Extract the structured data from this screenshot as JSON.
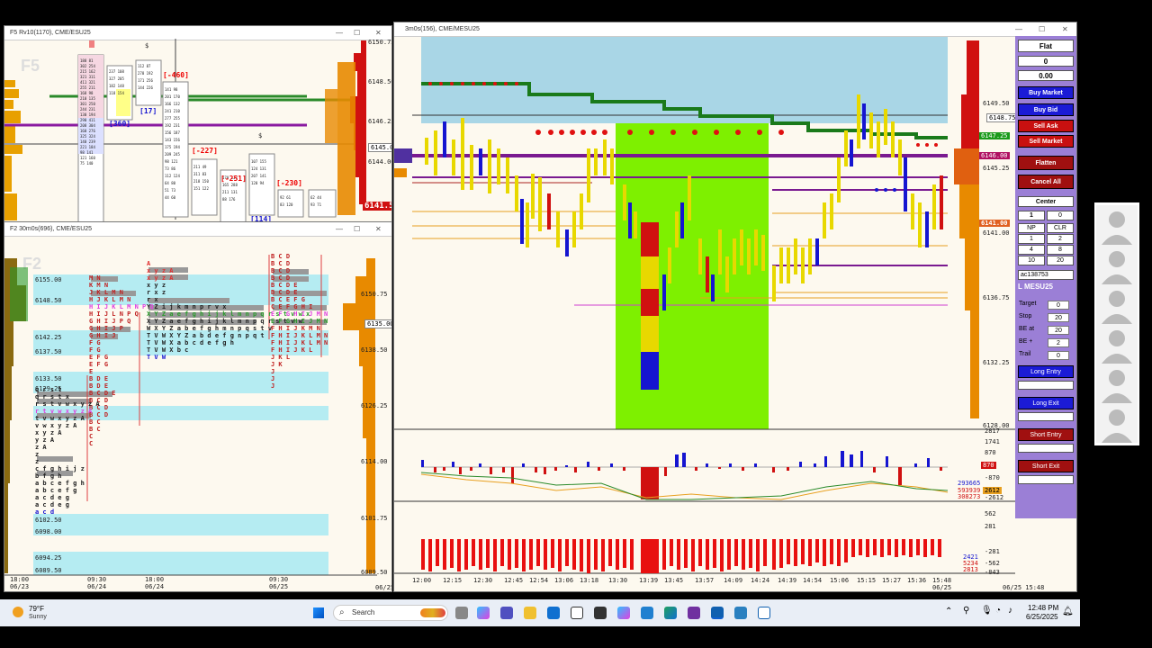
{
  "f5": {
    "title": "F5 Rv10(1170), CME/ESU25",
    "name": "F5",
    "prices": [
      "6150.75",
      "6148.50",
      "6146.25",
      "6144.00",
      "6141.50"
    ],
    "current_price": "6141.50",
    "mid_price": "6145.00",
    "labels_red": [
      "[-460]",
      "[-227]",
      "[-251]",
      "[-230]"
    ],
    "labels_blue": [
      "[360]",
      "[17]",
      "[114]"
    ],
    "dollar": "$"
  },
  "f2": {
    "title": "F2 30m0s(696), CME/ESU25",
    "name": "F2",
    "band_prices": [
      "6155.00",
      "6148.50",
      "6142.25",
      "6137.50",
      "6133.50",
      "6129.25",
      "6102.50",
      "6098.00",
      "6094.25",
      "6089.50"
    ],
    "axis_prices": [
      "6150.75",
      "6138.50",
      "6126.25",
      "6114.00",
      "6101.75",
      "6089.50"
    ],
    "mid_tag": "6135.00",
    "time_labels": [
      {
        "time": "18:00",
        "date": "06/23"
      },
      {
        "time": "09:30",
        "date": "06/24"
      },
      {
        "time": "18:00",
        "date": "06/24"
      },
      {
        "time": "09:30",
        "date": "06/25"
      }
    ],
    "corner_date": "06/25",
    "profile_text": [
      "A",
      "x y z A",
      "x y z A",
      "x y z",
      "r x z",
      "r x",
      "Y Z i j k m n p r v x",
      "X Y Z a e f g h i j k l m n p q r s t v w x",
      "X Y Z a e f g h i j k l m n p q r s t v w",
      "W X Y Z a b e f g h m n p q s t v",
      "T V W X Y Z a b d e f g n p q t",
      "T V W X a b c d e f g h",
      "T V W X b c",
      "T V W"
    ]
  },
  "main": {
    "title": "3m0s(156), CME/MESU25",
    "right_prices": [
      "6149.50",
      "6147.25",
      "6146.00",
      "6145.25",
      "6141.00",
      "6141.00",
      "6136.75",
      "6132.25",
      "6128.00"
    ],
    "tag_green": "6147.25",
    "tag_red_1": "6146.00",
    "tag_red_2": "6141.00",
    "tag_white": "6148.75",
    "times": [
      "12:00",
      "12:15",
      "12:30",
      "12:45",
      "12:54",
      "13:06",
      "13:18",
      "13:30",
      "13:39",
      "13:45",
      "13:57",
      "14:09",
      "14:24",
      "14:39",
      "14:54",
      "15:06",
      "15:15",
      "15:27",
      "15:36",
      "15:48"
    ],
    "last_date": "06/25",
    "corner_stamp": "06/25 15:48",
    "ind1_axis": [
      "2817",
      "1741",
      "870",
      "0",
      "-870",
      "-2612"
    ],
    "ind1_vals": [
      "293665",
      "593939",
      "308273"
    ],
    "ind1_tag": "870",
    "ind1_tag2": "2612",
    "ind2_axis": [
      "562",
      "281",
      "0",
      "-281",
      "-562",
      "-843"
    ],
    "ind2_vals": [
      "2421",
      "5234",
      "2813"
    ]
  },
  "panel": {
    "position_status": "Flat",
    "qty": "0",
    "pnl": "0.00",
    "buttons_blue": [
      "Buy Market",
      "Buy Bid"
    ],
    "buttons_red": [
      "Sell Ask",
      "Sell Market",
      "Flatten",
      "Cancel All"
    ],
    "center": "Center",
    "qty_input": "1",
    "qty_right": "0",
    "grid": [
      [
        "NP",
        "CLR"
      ],
      [
        "1",
        "2"
      ],
      [
        "4",
        "8"
      ],
      [
        "10",
        "20"
      ]
    ],
    "account": "ac138753",
    "symbol": "L MESU25",
    "fields": [
      {
        "label": "Target",
        "value": "0"
      },
      {
        "label": "Stop",
        "value": "20"
      },
      {
        "label": "BE at",
        "value": "20"
      },
      {
        "label": "BE +",
        "value": "2"
      },
      {
        "label": "Trail",
        "value": "0"
      }
    ],
    "long_entry": "Long Entry",
    "long_exit": "Long Exit",
    "short_entry": "Short Entry",
    "short_exit": "Short Exit"
  },
  "taskbar": {
    "temp": "79°F",
    "weather": "Sunny",
    "search_placeholder": "Search",
    "time": "12:48 PM",
    "date": "6/25/2025"
  },
  "colors": {
    "accent_purple": "#9b7fd6",
    "buy_blue": "#1b1bd6",
    "sell_red": "#c81010",
    "highlight_green": "#7ef000",
    "band_cyan": "#b5ecf2"
  }
}
